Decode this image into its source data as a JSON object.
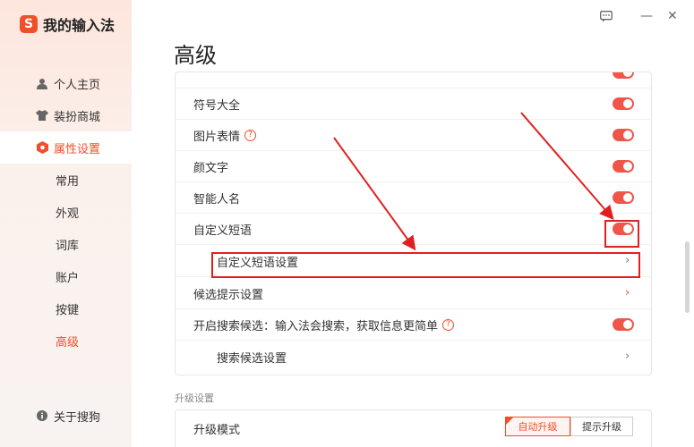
{
  "app": {
    "logo_letter": "S",
    "title": "我的输入法"
  },
  "window": {
    "feedback_icon": "feedback-icon",
    "minimize": "—",
    "close": "✕"
  },
  "sidebar": {
    "nav": [
      {
        "label": "个人主页",
        "icon": "user-icon"
      },
      {
        "label": "装扮商城",
        "icon": "shirt-icon"
      },
      {
        "label": "属性设置",
        "icon": "hexagon-gear-icon"
      }
    ],
    "sub": [
      "常用",
      "外观",
      "词库",
      "账户",
      "按键",
      "高级"
    ],
    "about": {
      "label": "关于搜狗",
      "icon": "info-icon"
    }
  },
  "page": {
    "title": "高级",
    "rows": [
      {
        "label": "符号大全",
        "control": "toggle",
        "on": true
      },
      {
        "label": "图片表情",
        "help": "?",
        "control": "toggle",
        "on": true
      },
      {
        "label": "颜文字",
        "control": "toggle",
        "on": true
      },
      {
        "label": "智能人名",
        "control": "toggle",
        "on": true
      },
      {
        "label": "自定义短语",
        "control": "toggle",
        "on": true
      },
      {
        "label": "自定义短语设置",
        "control": "chevron"
      },
      {
        "label": "候选提示设置",
        "control": "chevron"
      },
      {
        "label": "开启搜索候选：输入法会搜索，获取信息更简单",
        "help": "?",
        "control": "toggle",
        "on": true
      },
      {
        "label": "搜索候选设置",
        "control": "chevron"
      }
    ],
    "chevron_glyph": "›",
    "upgrade": {
      "section_title": "升级设置",
      "mode_label": "升级模式",
      "options": [
        "自动升级",
        "提示升级"
      ],
      "selected": "自动升级"
    }
  },
  "colors": {
    "accent": "#f14e2a",
    "toggle_on": "#f0554a",
    "annotation": "#e02020"
  }
}
